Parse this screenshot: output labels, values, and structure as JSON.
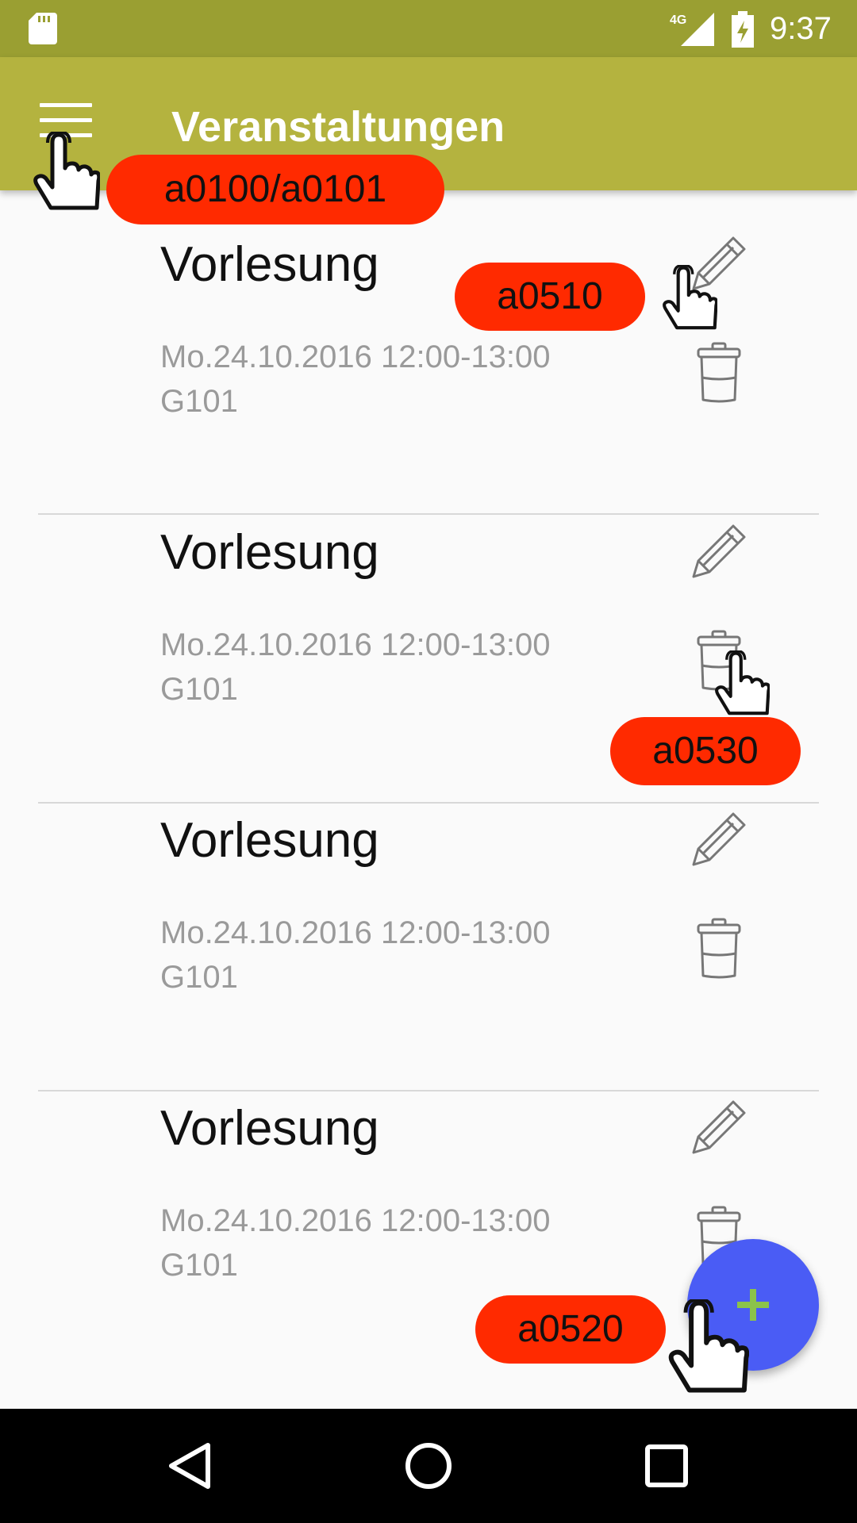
{
  "status_bar": {
    "time": "9:37",
    "network": "4G",
    "icons": [
      "sd-card-icon",
      "signal-icon",
      "battery-charging-icon"
    ]
  },
  "app_bar": {
    "title": "Veranstaltungen",
    "menu_icon": "hamburger-menu-icon"
  },
  "events": [
    {
      "title": "Vorlesung",
      "date": "Mo.24.10.2016 12:00-13:00",
      "room": "G101"
    },
    {
      "title": "Vorlesung",
      "date": "Mo.24.10.2016 12:00-13:00",
      "room": "G101"
    },
    {
      "title": "Vorlesung",
      "date": "Mo.24.10.2016 12:00-13:00",
      "room": "G101"
    },
    {
      "title": "Vorlesung",
      "date": "Mo.24.10.2016 12:00-13:00",
      "room": "G101"
    }
  ],
  "row_icons": {
    "edit": "pencil-icon",
    "delete": "trash-icon"
  },
  "fab": {
    "icon": "plus-icon",
    "color": "#4A5CF5",
    "icon_color": "#8BC34A"
  },
  "annotations": {
    "menu": "a0100/a0101",
    "edit": "a0510",
    "delete": "a0530",
    "add": "a0520",
    "color": "#FF2A00"
  },
  "nav_bar": {
    "icons": [
      "back-icon",
      "home-icon",
      "recents-icon"
    ]
  },
  "colors": {
    "status_bar": "#9A9F32",
    "app_bar": "#B4B33F",
    "background": "#FAFAFA"
  }
}
